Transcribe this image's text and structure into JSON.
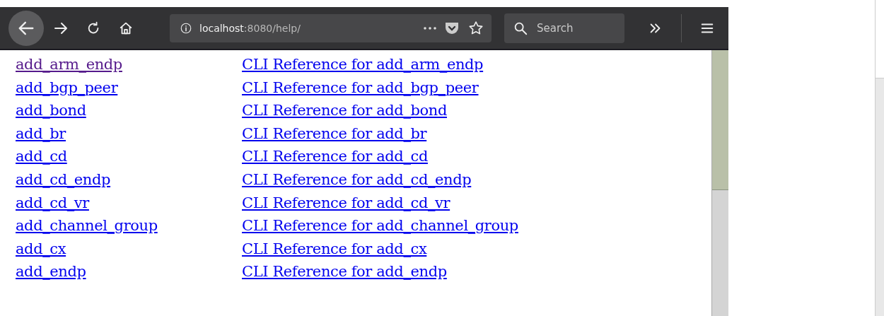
{
  "toolbar": {
    "url_host": "localhost",
    "url_rest": ":8080/help/",
    "search": {
      "placeholder": "Search"
    }
  },
  "links": [
    {
      "command": "add_arm_endp",
      "reference": "CLI Reference for add_arm_endp",
      "visited": true
    },
    {
      "command": "add_bgp_peer",
      "reference": "CLI Reference for add_bgp_peer",
      "visited": false
    },
    {
      "command": "add_bond",
      "reference": "CLI Reference for add_bond",
      "visited": false
    },
    {
      "command": "add_br",
      "reference": "CLI Reference for add_br",
      "visited": false
    },
    {
      "command": "add_cd",
      "reference": "CLI Reference for add_cd",
      "visited": false
    },
    {
      "command": "add_cd_endp",
      "reference": "CLI Reference for add_cd_endp",
      "visited": false
    },
    {
      "command": "add_cd_vr",
      "reference": "CLI Reference for add_cd_vr",
      "visited": false
    },
    {
      "command": "add_channel_group",
      "reference": "CLI Reference for add_channel_group",
      "visited": false
    },
    {
      "command": "add_cx",
      "reference": "CLI Reference for add_cx",
      "visited": false
    },
    {
      "command": "add_endp",
      "reference": "CLI Reference for add_endp",
      "visited": false
    }
  ]
}
